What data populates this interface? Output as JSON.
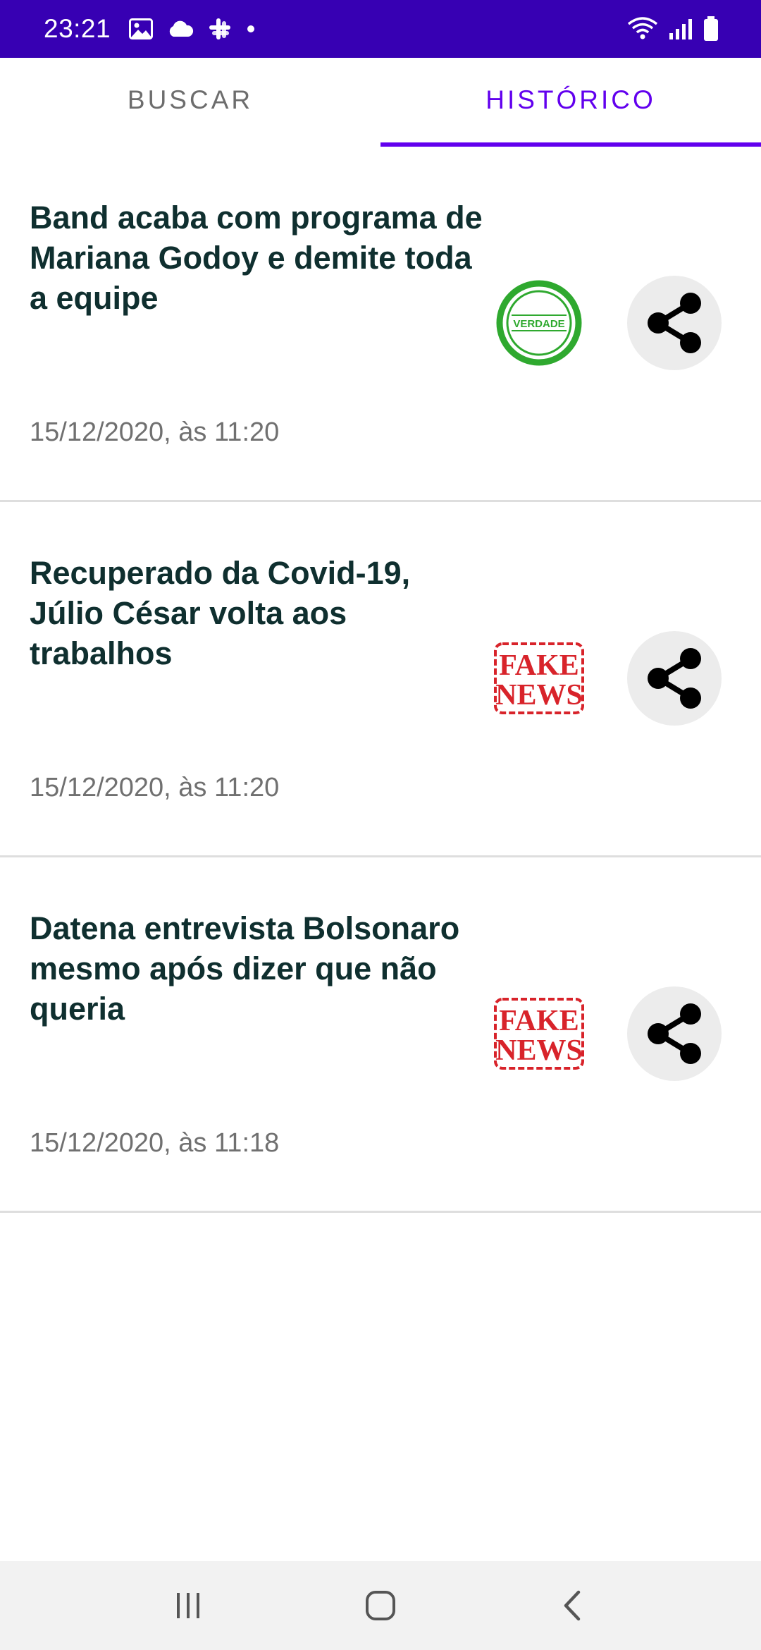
{
  "status_bar": {
    "time": "23:21",
    "left_icons": [
      "image-icon",
      "cloud-icon",
      "slack-icon",
      "dot-icon"
    ],
    "right_icons": [
      "wifi-icon",
      "signal-icon",
      "battery-icon"
    ],
    "background": "#3700b3"
  },
  "tabs": [
    {
      "label": "BUSCAR",
      "active": false
    },
    {
      "label": "HISTÓRICO",
      "active": true
    }
  ],
  "accent_color": "#6200ee",
  "history": [
    {
      "title": "Band acaba com programa de Mariana Godoy e demite toda a equipe",
      "date": "15/12/2020, às 11:20",
      "verdict": "verdade",
      "badge_text": "VERDADE"
    },
    {
      "title": "Recuperado da Covid-19, Júlio César volta aos trabalhos",
      "date": "15/12/2020, às 11:20",
      "verdict": "fake",
      "badge_text": [
        "FAKE",
        "NEWS"
      ]
    },
    {
      "title": "Datena entrevista Bolsonaro mesmo após dizer que não queria",
      "date": "15/12/2020, às 11:18",
      "verdict": "fake",
      "badge_text": [
        "FAKE",
        "NEWS"
      ]
    }
  ],
  "nav_bar": {
    "buttons": [
      "recent-apps-icon",
      "home-icon",
      "back-icon"
    ]
  }
}
